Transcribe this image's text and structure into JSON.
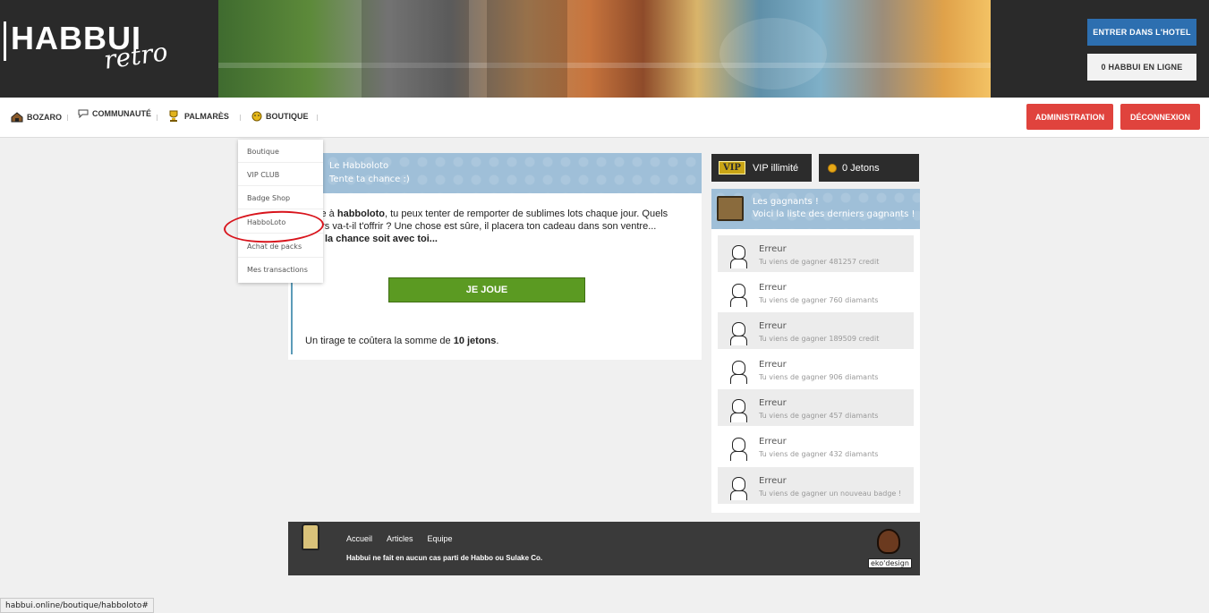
{
  "header": {
    "logo_text": "HABBUI",
    "logo_script": "retro",
    "enter_button": "ENTRER DANS L'HOTEL",
    "online_count": "0",
    "online_label": "HABBUI EN LIGNE"
  },
  "nav": {
    "items": [
      {
        "label": "BOZARO",
        "icon": "house-icon"
      },
      {
        "label": "COMMUNAUTÉ",
        "icon": "speech-bubble-icon"
      },
      {
        "label": "PALMARÈS",
        "icon": "trophy-icon"
      },
      {
        "label": "BOUTIQUE",
        "icon": "smiley-coin-icon"
      }
    ],
    "admin_button": "ADMINISTRATION",
    "logout_button": "DÉCONNEXION"
  },
  "dropdown": {
    "items": [
      "Boutique",
      "VIP CLUB",
      "Badge Shop",
      "HabboLoto",
      "Achat de packs",
      "Mes transactions"
    ]
  },
  "main": {
    "title": "Le Habboloto",
    "subtitle": "Tente ta chance :)",
    "intro_pre": "ce à ",
    "intro_bold": "habboloto",
    "intro_line1_post": ", tu peux tenter de remporter de sublimes lots chaque jour. Quels",
    "intro_line2": "ors va-t-il t'offrir ? Une chose est sûre, il placera ton cadeau dans son ventre...",
    "intro_line3_bold": "la chance soit avec toi...",
    "play_button": "JE JOUE",
    "cost_pre": "Un tirage te coûtera la somme de ",
    "cost_bold": "10 jetons",
    "cost_post": "."
  },
  "sidebar": {
    "vip_tag": "VIP",
    "vip_label": "VIP illimité",
    "jetons_label": "0 Jetons",
    "winners_title": "Les gagnants !",
    "winners_subtitle": "Voici la liste des derniers gagnants !",
    "winners": [
      {
        "name": "Erreur",
        "desc": "Tu viens de gagner 481257 credit"
      },
      {
        "name": "Erreur",
        "desc": "Tu viens de gagner 760 diamants"
      },
      {
        "name": "Erreur",
        "desc": "Tu viens de gagner 189509 credit"
      },
      {
        "name": "Erreur",
        "desc": "Tu viens de gagner 906 diamants"
      },
      {
        "name": "Erreur",
        "desc": "Tu viens de gagner 457 diamants"
      },
      {
        "name": "Erreur",
        "desc": "Tu viens de gagner 432 diamants"
      },
      {
        "name": "Erreur",
        "desc": "Tu viens de gagner un nouveau badge !"
      }
    ]
  },
  "footer": {
    "links": [
      "Accueil",
      "Articles",
      "Equipe"
    ],
    "note": "Habbui ne fait en aucun cas parti de Habbo ou Sulake Co.",
    "credit": "eko'design"
  },
  "status_url": "habbui.online/boutique/habboloto#",
  "colors": {
    "accent_blue": "#2d6fb0",
    "danger_red": "#e0433d",
    "play_green": "#5b9a22",
    "panel_head": "#9fbfd8"
  }
}
